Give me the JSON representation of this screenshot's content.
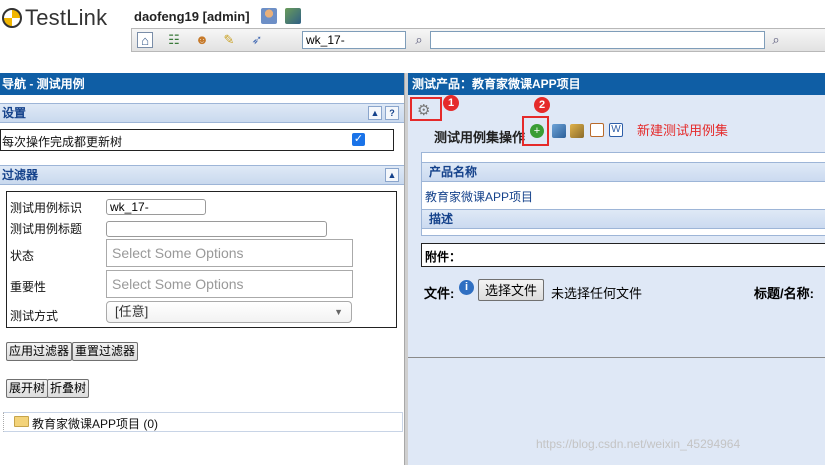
{
  "app": {
    "logo_text": "TestLink",
    "user": "daofeng19 [admin]"
  },
  "header": {
    "toolbar_icons": [
      "home-icon",
      "sitemap-icon",
      "user-icon",
      "broom-icon",
      "rocket-icon"
    ],
    "search_value": "wk_17-",
    "search2_value": ""
  },
  "left": {
    "title": "导航 - 测试用例",
    "settings": {
      "title": "设置",
      "update_tree_label": "每次操作完成都更新树",
      "update_tree_checked": true
    },
    "filters": {
      "title": "过滤器",
      "tc_id_label": "测试用例标识",
      "tc_id_value": "wk_17-",
      "tc_title_label": "测试用例标题",
      "tc_title_value": "",
      "status_label": "状态",
      "status_placeholder": "Select Some Options",
      "importance_label": "重要性",
      "importance_placeholder": "Select Some Options",
      "exec_type_label": "测试方式",
      "exec_type_value": "[任意]"
    },
    "apply_filter": "应用过滤器",
    "reset_filter": "重置过滤器",
    "expand_tree": "展开树",
    "collapse_tree": "折叠树",
    "tree_root": "教育家微课APP项目 (0)"
  },
  "right": {
    "title": "测试产品：教育家微课APP项目",
    "badge1": "1",
    "badge2": "2",
    "suite_ops_label": "测试用例集操作",
    "annotation": "新建测试用例集",
    "product_name_header": "产品名称",
    "product_name_value": "教育家微课APP项目",
    "description_header": "描述",
    "attachments_label": "附件：",
    "file_label": "文件:",
    "choose_file": "选择文件",
    "no_file": "未选择任何文件",
    "title_name_label": "标题/名称:"
  },
  "watermark": "https://blog.csdn.net/weixin_45294964",
  "colors": {
    "header_blue": "#0f5ea5",
    "accent_red": "#e52a2a",
    "panel_bg": "#dfe8f6",
    "section_text": "#15428b"
  }
}
